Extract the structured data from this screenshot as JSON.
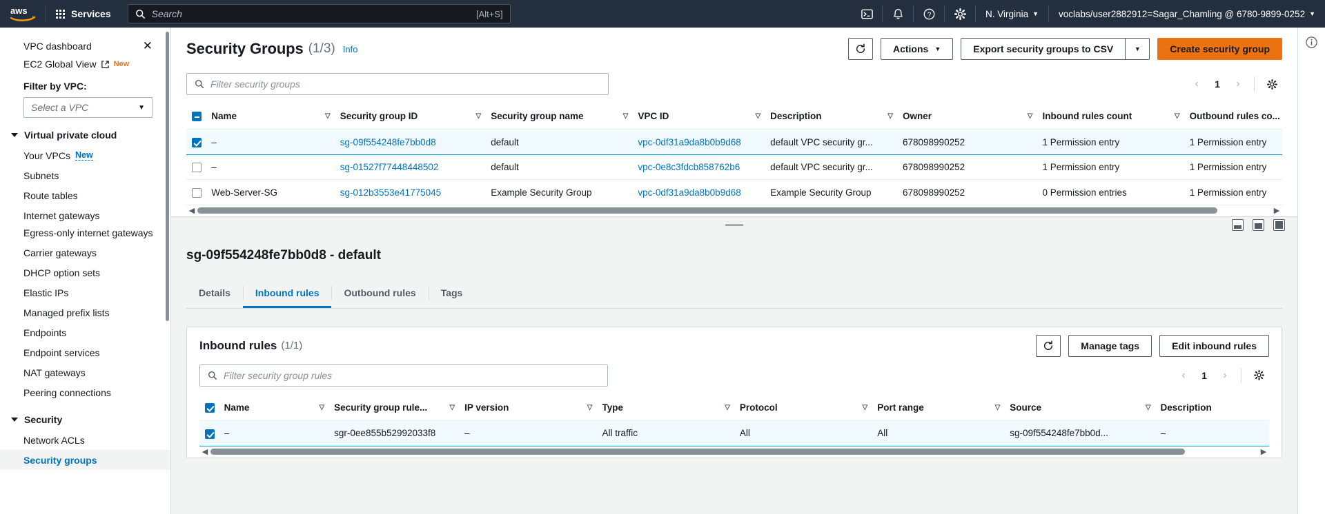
{
  "topnav": {
    "logo": "aws-logo",
    "services_label": "Services",
    "search_placeholder": "Search",
    "search_value": "",
    "search_shortcut": "[Alt+S]",
    "icons": [
      "cloudshell-icon",
      "notifications-bell-icon",
      "help-question-icon",
      "settings-gear-icon"
    ],
    "region_label": "N. Virginia",
    "account_label": "voclabs/user2882912=Sagar_Chamling @ 6780-9899-0252"
  },
  "sidebar": {
    "dashboard_label": "VPC dashboard",
    "close_icon": "close-icon",
    "global_view_label": "EC2 Global View",
    "global_view_badge": "New",
    "filter_label": "Filter by VPC:",
    "vpc_select_value": "Select a VPC",
    "groups": [
      {
        "label": "Virtual private cloud",
        "items": [
          {
            "label": "Your VPCs",
            "badge": "New"
          },
          {
            "label": "Subnets"
          },
          {
            "label": "Route tables"
          },
          {
            "label": "Internet gateways"
          },
          {
            "label": "Egress-only internet gateways"
          },
          {
            "label": "Carrier gateways"
          },
          {
            "label": "DHCP option sets"
          },
          {
            "label": "Elastic IPs"
          },
          {
            "label": "Managed prefix lists"
          },
          {
            "label": "Endpoints"
          },
          {
            "label": "Endpoint services"
          },
          {
            "label": "NAT gateways"
          },
          {
            "label": "Peering connections"
          }
        ]
      },
      {
        "label": "Security",
        "items": [
          {
            "label": "Network ACLs"
          },
          {
            "label": "Security groups",
            "active": true
          }
        ]
      }
    ]
  },
  "page": {
    "title": "Security Groups",
    "count": "(1/3)",
    "info_label": "Info",
    "refresh_icon": "refresh-icon",
    "actions_label": "Actions",
    "export_label": "Export security groups to CSV",
    "create_label": "Create security group",
    "filter_placeholder": "Filter security groups",
    "filter_value": "",
    "page_number": "1",
    "prefs_icon": "settings-gear-icon"
  },
  "sg_table": {
    "columns": [
      "Name",
      "Security group ID",
      "Security group name",
      "VPC ID",
      "Description",
      "Owner",
      "Inbound rules count",
      "Outbound rules co..."
    ],
    "rows": [
      {
        "selected": true,
        "name": "–",
        "sg_id": "sg-09f554248fe7bb0d8",
        "sg_name": "default",
        "vpc_id": "vpc-0df31a9da8b0b9d68",
        "description": "default VPC security gr...",
        "owner": "678098990252",
        "inbound": "1 Permission entry",
        "outbound": "1 Permission entry"
      },
      {
        "selected": false,
        "name": "–",
        "sg_id": "sg-01527f77448448502",
        "sg_name": "default",
        "vpc_id": "vpc-0e8c3fdcb858762b6",
        "description": "default VPC security gr...",
        "owner": "678098990252",
        "inbound": "1 Permission entry",
        "outbound": "1 Permission entry"
      },
      {
        "selected": false,
        "name": "Web-Server-SG",
        "sg_id": "sg-012b3553e41775045",
        "sg_name": "Example Security Group",
        "vpc_id": "vpc-0df31a9da8b0b9d68",
        "description": "Example Security Group",
        "owner": "678098990252",
        "inbound": "0 Permission entries",
        "outbound": "1 Permission entry"
      }
    ]
  },
  "detail": {
    "title": "sg-09f554248fe7bb0d8 - default",
    "tabs": [
      {
        "label": "Details",
        "active": false
      },
      {
        "label": "Inbound rules",
        "active": true
      },
      {
        "label": "Outbound rules",
        "active": false
      },
      {
        "label": "Tags",
        "active": false
      }
    ],
    "panel_icons": [
      "split-bottom-icon",
      "split-medium-icon",
      "split-full-icon"
    ]
  },
  "inbound": {
    "title": "Inbound rules",
    "count": "(1/1)",
    "refresh_icon": "refresh-icon",
    "manage_tags_label": "Manage tags",
    "edit_label": "Edit inbound rules",
    "filter_placeholder": "Filter security group rules",
    "filter_value": "",
    "page_number": "1",
    "prefs_icon": "settings-gear-icon",
    "columns": [
      "Name",
      "Security group rule...",
      "IP version",
      "Type",
      "Protocol",
      "Port range",
      "Source",
      "Description"
    ],
    "rows": [
      {
        "selected": true,
        "name": "–",
        "rule_id": "sgr-0ee855b52992033f8",
        "ip_version": "–",
        "type": "All traffic",
        "protocol": "All",
        "port_range": "All",
        "source": "sg-09f554248fe7bb0d...",
        "description": "–"
      }
    ]
  },
  "colors": {
    "nav_bg": "#232f3e",
    "accent_orange": "#ec7211",
    "link_blue": "#0073bb",
    "selected_row": "#f1faff",
    "selected_border": "#00a1c9"
  }
}
